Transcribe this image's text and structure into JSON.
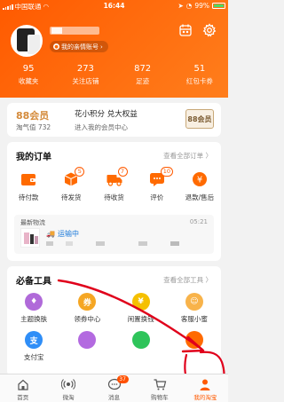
{
  "status_bar": {
    "carrier": "中国联通",
    "time": "16:44",
    "battery": "99%"
  },
  "profile": {
    "account_label": "我的亲情账号"
  },
  "stats": [
    {
      "num": "95",
      "label": "收藏夹"
    },
    {
      "num": "273",
      "label": "关注店铺"
    },
    {
      "num": "872",
      "label": "足迹"
    },
    {
      "num": "51",
      "label": "红包卡券"
    }
  ],
  "vip": {
    "title": "88会员",
    "sub": "淘气值 732",
    "main": "花小积分 兑大权益",
    "desc": "进入我的会员中心",
    "badge": "88会员"
  },
  "orders": {
    "title": "我的订单",
    "more": "查看全部订单 〉",
    "items": [
      {
        "label": "待付款",
        "badge": ""
      },
      {
        "label": "待发货",
        "badge": "5"
      },
      {
        "label": "待收货",
        "badge": "7"
      },
      {
        "label": "评价",
        "badge": "10"
      },
      {
        "label": "退款/售后",
        "badge": ""
      }
    ],
    "logistics": {
      "title": "最新物流",
      "time": "05:21",
      "status": "运输中"
    }
  },
  "tools": {
    "title": "必备工具",
    "more": "查看全部工具 〉",
    "items": [
      {
        "label": "主题换肤",
        "glyph": "♦",
        "color": "#b06ad9"
      },
      {
        "label": "领券中心",
        "glyph": "券",
        "color": "#f5a623"
      },
      {
        "label": "闲置换钱",
        "glyph": "¥",
        "color": "#f5c000"
      },
      {
        "label": "客服小蜜",
        "glyph": "☺",
        "color": "#f8b34a"
      },
      {
        "label": "支付宝",
        "glyph": "支",
        "color": "#2f8ef7"
      },
      {
        "label": "",
        "glyph": "",
        "color": "#b36ae0"
      },
      {
        "label": "",
        "glyph": "",
        "color": "#2ec45a"
      },
      {
        "label": "",
        "glyph": "",
        "color": "#ff6a00"
      }
    ]
  },
  "tabbar": [
    {
      "label": "首页",
      "icon": "home-icon",
      "badge": ""
    },
    {
      "label": "微淘",
      "icon": "broadcast-icon",
      "badge": ""
    },
    {
      "label": "消息",
      "icon": "message-icon",
      "badge": "37"
    },
    {
      "label": "购物车",
      "icon": "cart-icon",
      "badge": ""
    },
    {
      "label": "我的淘宝",
      "icon": "user-icon",
      "badge": ""
    }
  ],
  "colors": {
    "brand": "#ff5a00",
    "annotation": "#e0001b"
  }
}
